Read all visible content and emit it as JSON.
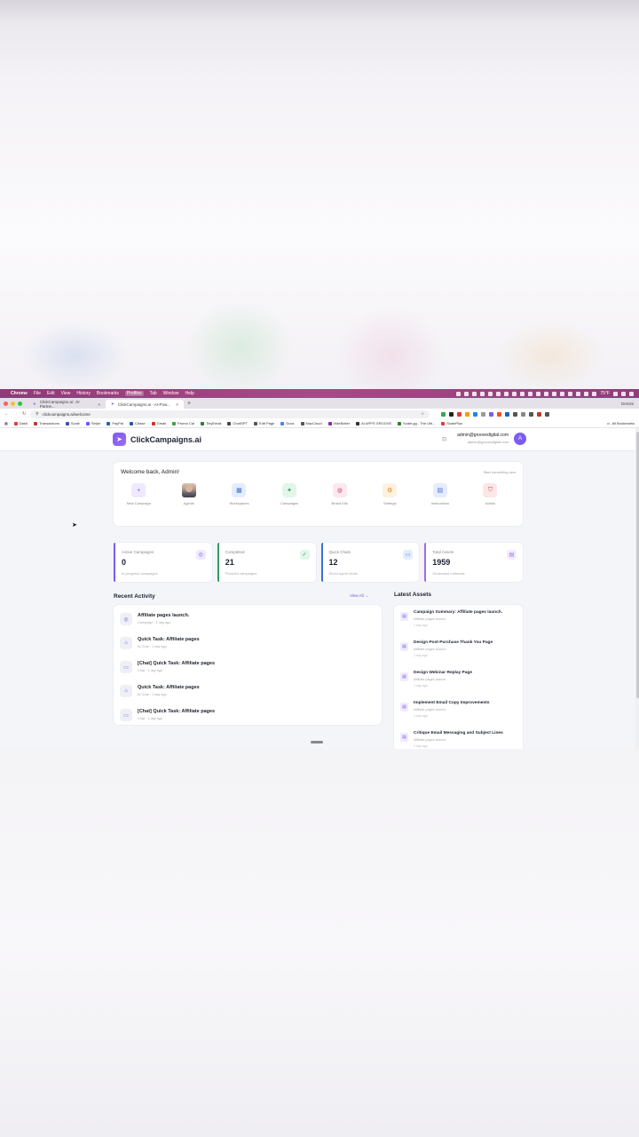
{
  "menubar": {
    "app": "Chrome",
    "items": [
      "File",
      "Edit",
      "View",
      "History",
      "Bookmarks",
      "Profiles",
      "Tab",
      "Window",
      "Help"
    ],
    "temp": "75°F",
    "gemini": "Gemini"
  },
  "tabs": [
    {
      "title": "ClickCampaigns.ai: JV Partne..."
    },
    {
      "title": "ClickCampaigns.ai - AI-Pow..."
    }
  ],
  "toolbar": {
    "url": "clickcampaigns.ai/welcome"
  },
  "bookmarks": [
    {
      "label": "Dash",
      "color": "#e53935"
    },
    {
      "label": "Transactions",
      "color": "#c0392b"
    },
    {
      "label": "Scale",
      "color": "#3f51b5"
    },
    {
      "label": "Stripe",
      "color": "#635bff"
    },
    {
      "label": "PayPal",
      "color": "#1565c0"
    },
    {
      "label": "Chase",
      "color": "#1e5aa8"
    },
    {
      "label": "Gmail",
      "color": "#d93025"
    },
    {
      "label": "Promo Cal",
      "color": "#43a047"
    },
    {
      "label": "TinyEmail",
      "color": "#2e7d32"
    },
    {
      "label": "ChatGPT",
      "color": "#444"
    },
    {
      "label": "Edit Page",
      "color": "#555"
    },
    {
      "label": "Docs",
      "color": "#4285f4"
    },
    {
      "label": "MacCloud",
      "color": "#555"
    },
    {
      "label": "VideBotter",
      "color": "#8e24aa"
    },
    {
      "label": "AI APPS GROOVE",
      "color": "#333"
    },
    {
      "label": "Scale.gg - The Ulti...",
      "color": "#2e7d32"
    },
    {
      "label": "ScalePlus",
      "color": "#e53935"
    }
  ],
  "all_bookmarks": "All Bookmarks",
  "header": {
    "brand": "ClickCampaigns.ai",
    "email": "admin@groovedigital.com",
    "email2": "admin@groovedigital.com",
    "avatar": "A"
  },
  "welcome": {
    "title": "Welcome back, Admin!",
    "subtitle": "Start something new",
    "actions": [
      {
        "label": "New Campaign",
        "glyph": "+",
        "bg": "#eee9fd",
        "fg": "#7c5cf0"
      },
      {
        "label": "Agents",
        "glyph": "",
        "bg": "",
        "fg": ""
      },
      {
        "label": "Workspaces",
        "glyph": "▦",
        "bg": "#e4edfd",
        "fg": "#3b6fd8"
      },
      {
        "label": "Campaigns",
        "glyph": "✦",
        "bg": "#e2f6ea",
        "fg": "#2e9e5b"
      },
      {
        "label": "Brand Kits",
        "glyph": "◍",
        "bg": "#fde7ef",
        "fg": "#d64a7e"
      },
      {
        "label": "Settings",
        "glyph": "⚙",
        "bg": "#fdf1e0",
        "fg": "#d98a1c"
      },
      {
        "label": "Instructions",
        "glyph": "▤",
        "bg": "#e6ecfd",
        "fg": "#4766d6"
      },
      {
        "label": "Admin",
        "glyph": "⛉",
        "bg": "#fde6e6",
        "fg": "#d64a4a"
      }
    ]
  },
  "stats": [
    {
      "label": "Active Campaigns",
      "value": "0",
      "sub": "In-progress campaigns",
      "color": "#7c5cf0",
      "icon": "◎",
      "icon_bg": "#eee9fd"
    },
    {
      "label": "Completed",
      "value": "21",
      "sub": "Finished campaigns",
      "color": "#2e9e5b",
      "icon": "✓",
      "icon_bg": "#e2f6ea"
    },
    {
      "label": "Quick Chats",
      "value": "12",
      "sub": "Direct agent chats",
      "color": "#3b6fd8",
      "icon": "▭",
      "icon_bg": "#e4edfd"
    },
    {
      "label": "Total Assets",
      "value": "1959",
      "sub": "Generated materials",
      "color": "#9b6bf5",
      "icon": "▤",
      "icon_bg": "#f1ecfd"
    }
  ],
  "recent": {
    "title": "Recent Activity",
    "view_all": "View All",
    "items": [
      {
        "title": "Affiliate pages launch.",
        "type": "Campaign",
        "time": "1 day ago",
        "glyph": "◎"
      },
      {
        "title": "Quick Task: Affiliate pages",
        "type": "AI Chat",
        "time": "1 day ago",
        "glyph": "⌂"
      },
      {
        "title": "[Chat] Quick Task: Affiliate pages",
        "type": "Chat",
        "time": "1 day ago",
        "glyph": "▭"
      },
      {
        "title": "Quick Task: Affiliate pages",
        "type": "AI Chat",
        "time": "1 day ago",
        "glyph": "⌂"
      },
      {
        "title": "[Chat] Quick Task: Affiliate pages",
        "type": "Chat",
        "time": "1 day ago",
        "glyph": "▭"
      }
    ]
  },
  "latest": {
    "title": "Latest Assets",
    "items": [
      {
        "title": "Campaign Summary: Affiliate pages launch.",
        "campaign": "Affiliate pages launch.",
        "time": "1 day ago"
      },
      {
        "title": "Design Post-Purchase Thank You Page",
        "campaign": "Affiliate pages launch.",
        "time": "1 day ago"
      },
      {
        "title": "Design Webinar Replay Page",
        "campaign": "Affiliate pages launch.",
        "time": "1 day ago"
      },
      {
        "title": "Implement Email Copy Improvements",
        "campaign": "Affiliate pages launch.",
        "time": "1 day ago"
      },
      {
        "title": "Critique Email Messaging and Subject Lines",
        "campaign": "Affiliate pages launch.",
        "time": "1 day ago"
      }
    ]
  }
}
